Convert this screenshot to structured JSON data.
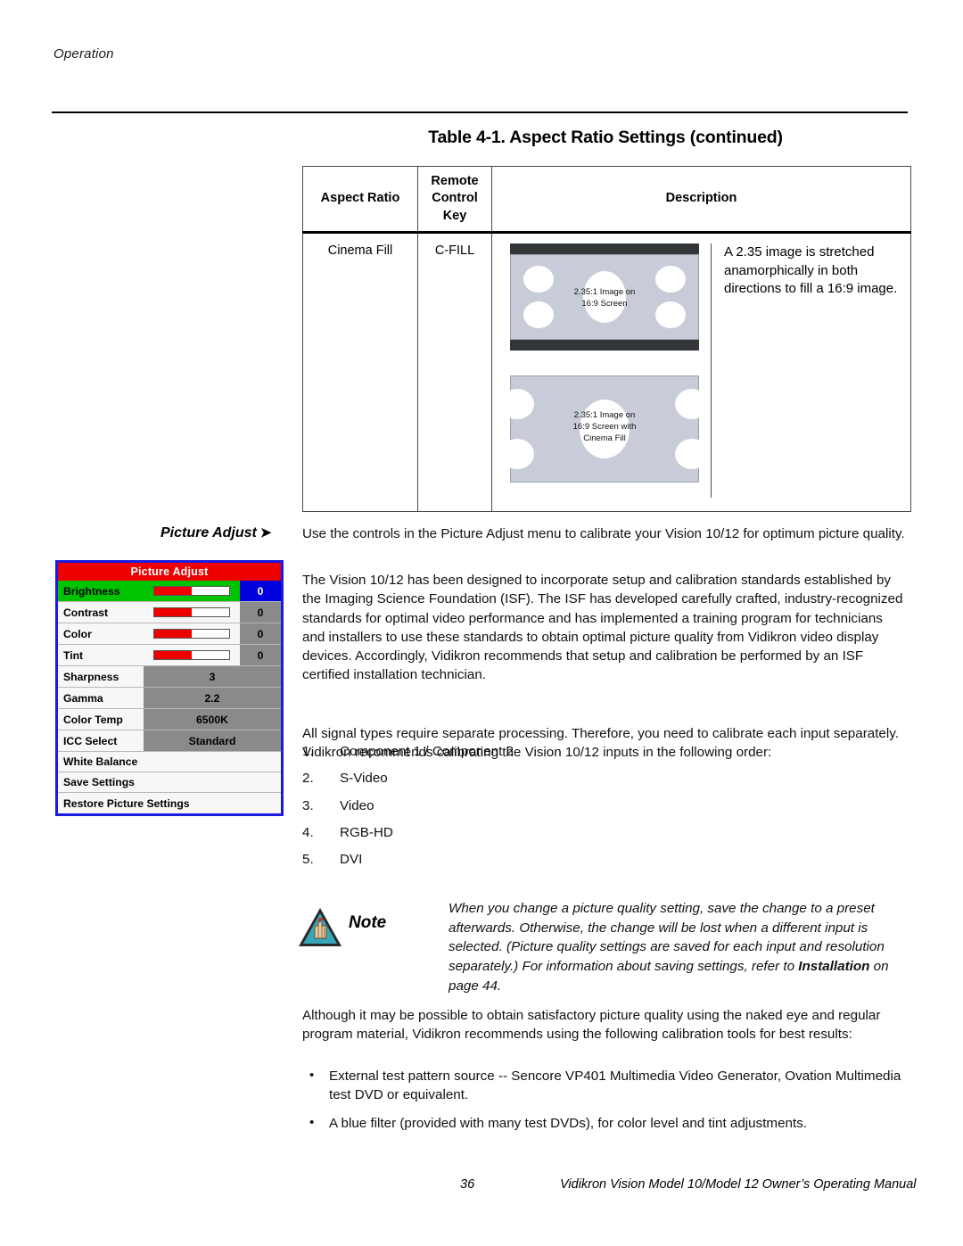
{
  "header": {
    "running_head": "Operation"
  },
  "table": {
    "title": "Table 4-1. Aspect Ratio Settings (continued)",
    "columns": [
      "Aspect Ratio",
      "Remote Control Key",
      "Description"
    ],
    "col_aspect_ratio": "Aspect Ratio",
    "col_remote_line1": "Remote",
    "col_remote_line2": "Control",
    "col_remote_line3": "Key",
    "col_description": "Description",
    "row": {
      "aspect_ratio": "Cinema Fill",
      "remote_key": "C-FILL",
      "description": "A 2.35 image is stretched anamorphically in both directions to fill a 16:9 image.",
      "diagram1_line1": "2.35:1 Image on",
      "diagram1_line2": "16:9 Screen",
      "diagram2_line1": "2.35:1 Image on",
      "diagram2_line2": "16:9 Screen with",
      "diagram2_line3": "Cinema Fill"
    }
  },
  "side_label": {
    "text": "Picture Adjust",
    "arrow": "➤"
  },
  "body": {
    "p1": "Use the controls in the Picture Adjust menu to calibrate your Vision 10/12 for optimum picture quality.",
    "p2": "The Vision 10/12 has been designed to incorporate setup and calibration standards established by the Imaging Science Foundation (ISF). The ISF has developed carefully crafted, industry-recognized standards for optimal video performance and has implemented a training program for technicians and installers to use these standards to obtain optimal picture quality from Vidikron video display devices. Accordingly, Vidikron recommends that setup and calibration be performed by an ISF certified installation technician.",
    "p3": "All signal types require separate processing. Therefore, you need to calibrate each input separately. Vidikron recommends calibrating the Vision 10/12 inputs in the following order:",
    "steps": [
      {
        "num": "1.",
        "label": "Component 1 / Component 2"
      },
      {
        "num": "2.",
        "label": "S-Video"
      },
      {
        "num": "3.",
        "label": "Video"
      },
      {
        "num": "4.",
        "label": "RGB-HD"
      },
      {
        "num": "5.",
        "label": "DVI"
      }
    ],
    "p4": "Although it may be possible to obtain satisfactory picture quality using the naked eye and regular program material, Vidikron recommends using the following calibration tools for best results:",
    "bullets": [
      "External test pattern source -- Sencore VP401 Multimedia Video Generator, Ovation Multimedia test DVD or equivalent.",
      "A blue filter (provided with many test DVDs), for color level and tint adjustments."
    ]
  },
  "note": {
    "word": "Note",
    "text_before": "When you change a picture quality setting, save the change to a preset afterwards. Otherwise, the change will be lost when a different input is selected. (Picture quality settings are saved for each input and resolution separately.) For information about saving settings, refer to ",
    "bold_ref": "Installation",
    "text_after": " on page 44."
  },
  "osd": {
    "title": "Picture Adjust",
    "colors": {
      "title_bg": "#ee0000",
      "selected_row_bg": "#00c400",
      "selected_value_bg": "#0000dd",
      "value_bg": "#8a8a8a",
      "border": "#1a1ae0",
      "slider_fill": "#ee0000"
    },
    "slider_rows": [
      {
        "label": "Brightness",
        "value": "0",
        "fill_percent": 50,
        "selected": true
      },
      {
        "label": "Contrast",
        "value": "0",
        "fill_percent": 50,
        "selected": false
      },
      {
        "label": "Color",
        "value": "0",
        "fill_percent": 50,
        "selected": false
      },
      {
        "label": "Tint",
        "value": "0",
        "fill_percent": 50,
        "selected": false
      }
    ],
    "value_rows": [
      {
        "label": "Sharpness",
        "value": "3"
      },
      {
        "label": "Gamma",
        "value": "2.2"
      },
      {
        "label": "Color Temp",
        "value": "6500K"
      },
      {
        "label": "ICC Select",
        "value": "Standard"
      }
    ],
    "plain_rows": [
      {
        "label": "White Balance"
      },
      {
        "label": "Save Settings"
      },
      {
        "label": "Restore Picture Settings"
      }
    ]
  },
  "footer": {
    "page_number": "36",
    "manual_title": "Vidikron Vision Model 10/Model 12 Owner’s Operating Manual"
  }
}
